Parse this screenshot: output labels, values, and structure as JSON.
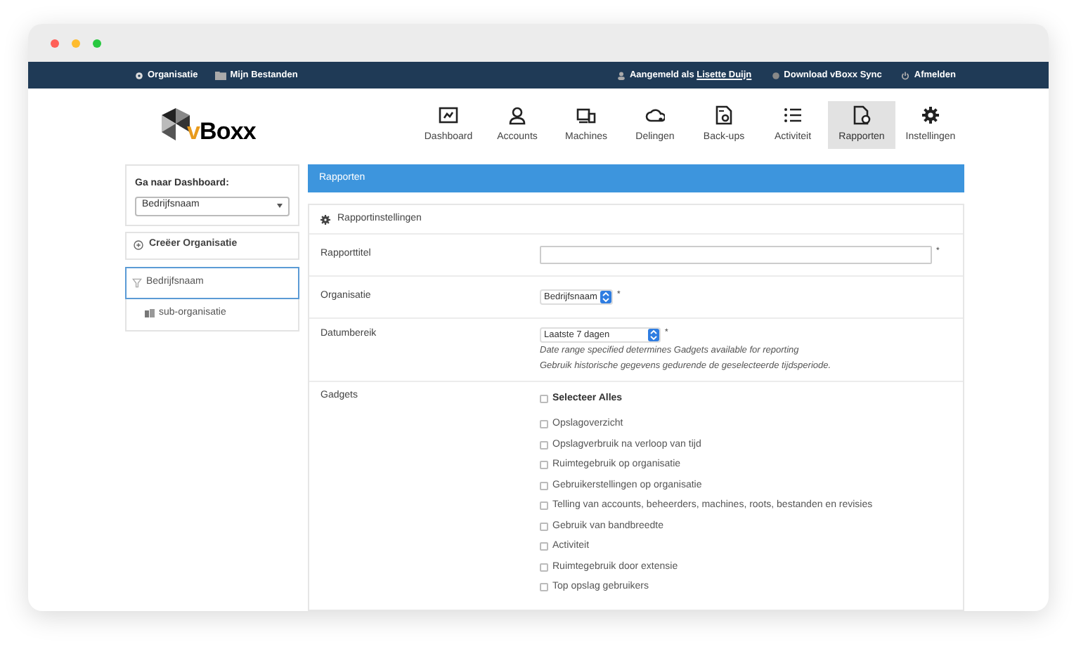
{
  "top_bar": {
    "left_links": [
      {
        "label": "Organisatie"
      },
      {
        "label": "Mijn Bestanden"
      }
    ],
    "user_prefix": "Aangemeld als",
    "user_name": "Lisette Duijn",
    "right_links": [
      {
        "label": "Download vBoxx Sync"
      },
      {
        "label": "Afmelden"
      }
    ]
  },
  "logo": {
    "mark": "v",
    "rest": "Boxx"
  },
  "nav": [
    {
      "label": "Dashboard",
      "selected": false
    },
    {
      "label": "Accounts",
      "selected": false
    },
    {
      "label": "Machines",
      "selected": false
    },
    {
      "label": "Delingen",
      "selected": false
    },
    {
      "label": "Back-ups",
      "selected": false
    },
    {
      "label": "Activiteit",
      "selected": false
    },
    {
      "label": "Rapporten",
      "selected": true
    },
    {
      "label": "Instellingen",
      "selected": false
    }
  ],
  "sidebar": {
    "dashboard_label": "Ga naar Dashboard:",
    "dashboard_select": "Bedrijfsnaam",
    "create_button": "Creëer Organisatie",
    "tree": [
      {
        "label": "Bedrijfsnaam",
        "selected": true,
        "children": [
          {
            "label": "sub-organisatie",
            "selected": false
          }
        ]
      }
    ]
  },
  "main": {
    "header": "Rapporten",
    "section_title": "Rapportinstellingen",
    "fields": [
      {
        "label": "Rapporttitel",
        "kind": "text",
        "required_mark": "*"
      },
      {
        "label": "Organisatie",
        "kind": "select",
        "value": "Bedrijfsnaam",
        "required_mark": "*"
      },
      {
        "label": "Datumbereik",
        "kind": "select",
        "value": "Laatste 7 dagen",
        "required_mark": "*",
        "hints": [
          "Date range specified determines Gadgets available for reporting",
          "Gebruik historische gegevens gedurende de geselecteerde tijdsperiode."
        ]
      }
    ],
    "gadgets": {
      "label": "Gadgets",
      "select_all": {
        "label": "Selecteer Alles",
        "checked": false
      },
      "items": [
        {
          "label": "Opslagoverzicht",
          "checked": false
        },
        {
          "label": "Opslagverbruik na verloop van tijd",
          "checked": false
        },
        {
          "label": "Ruimtegebruik op organisatie",
          "checked": false
        },
        {
          "label": "Gebruikerstellingen op organisatie",
          "checked": false
        },
        {
          "label": "Telling van accounts, beheerders, machines, roots, bestanden en revisies",
          "checked": false
        },
        {
          "label": "Gebruik van bandbreedte",
          "checked": false
        },
        {
          "label": "Activiteit",
          "checked": false
        },
        {
          "label": "Ruimtegebruik door extensie",
          "checked": false
        },
        {
          "label": "Top opslag gebruikers",
          "checked": false
        }
      ]
    }
  }
}
